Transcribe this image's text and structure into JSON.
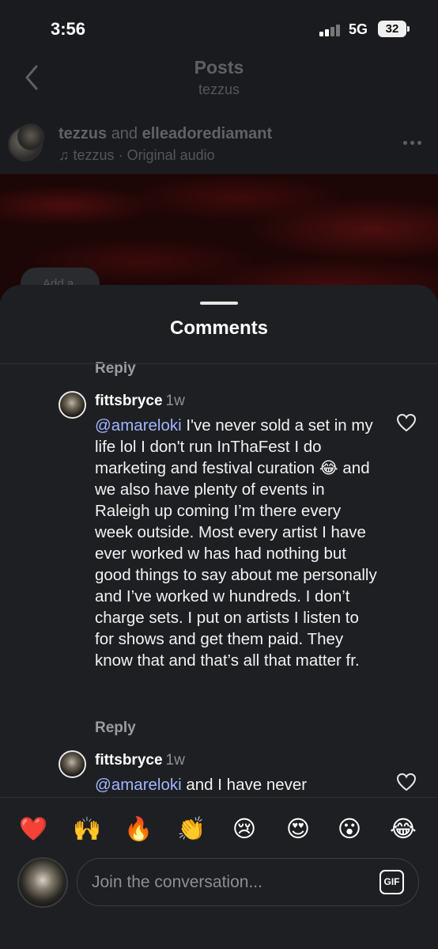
{
  "status_bar": {
    "time": "3:56",
    "network": "5G",
    "battery": "32"
  },
  "header": {
    "title": "Posts",
    "subtitle": "tezzus"
  },
  "post": {
    "author_1": "tezzus",
    "author_joiner": "and",
    "author_2": "elleadorediamant",
    "audio_owner": "tezzus",
    "audio_label": "Original audio",
    "add_pill": "Add a"
  },
  "comments_sheet": {
    "title": "Comments",
    "top_reply": "Reply",
    "comments": [
      {
        "username": "fittsbryce",
        "time": "1w",
        "mention": "@amareloki",
        "text_1": " I've never sold a set in my life lol I don't run InThaFest I do marketing and festival curation ",
        "emoji": "😂",
        "text_2": " and we also have plenty of events in Raleigh up coming I’m there every week outside. Most every artist I have ever worked w has had nothing but good things to say about me personally and I’ve worked w hundreds. I don’t charge sets. I put on artists I listen to for shows and get them paid. They know that and that’s all that matter fr.",
        "reply": "Reply"
      },
      {
        "username": "fittsbryce",
        "time": "1w",
        "mention": "@amareloki",
        "text_1": " and I have never"
      }
    ]
  },
  "reactions": [
    "❤️",
    "🙌",
    "🔥",
    "👏",
    "😢",
    "😍",
    "😮",
    "😂"
  ],
  "composer": {
    "placeholder": "Join the conversation...",
    "gif_label": "GIF"
  }
}
